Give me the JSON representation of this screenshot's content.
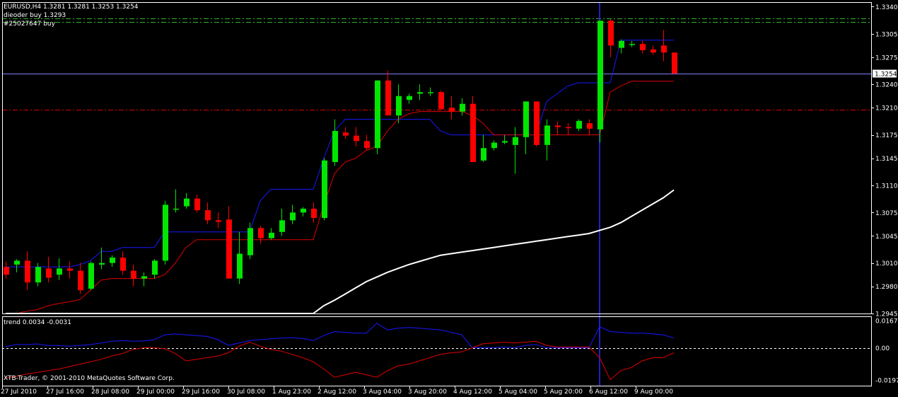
{
  "colors": {
    "background": "#000000",
    "foreground": "#ffffff",
    "bull": "#00e600",
    "bear": "#ff0000",
    "upper_band": "#1818ff",
    "lower_band": "#e00000",
    "ma": "#ffffff",
    "level_green": "#2fb52f",
    "level_red": "#e00000",
    "cursor_line": "#2a2aff",
    "bid_line": "#8080ff"
  },
  "header": {
    "symbol_line": "EURUSD,H4  1.3281 1.3281 1.3253 1.3254",
    "order_line_1": "dieoder buy  1.3293",
    "order_line_2": "#25027647 buy"
  },
  "indicator": {
    "label": "trend 0.0034 -0.0031",
    "axis_labels": [
      "0.0167",
      "0.00",
      "-0.0197"
    ]
  },
  "watermark": "XTB-Trader, © 2001-2010 MetaQuotes Software Corp.",
  "current_price": "1.3254",
  "chart_data": {
    "type": "candlestick",
    "symbol": "EURUSD",
    "timeframe": "H4",
    "ylim": [
      1.2945,
      1.3345
    ],
    "y_ticks": [
      "1.3340",
      "1.3305",
      "1.3275",
      "1.3240",
      "1.3210",
      "1.3175",
      "1.3145",
      "1.3110",
      "1.3075",
      "1.3045",
      "1.3010",
      "1.2980",
      "1.2945"
    ],
    "x_ticks": [
      "27 Jul 2010",
      "27 Jul 16:00",
      "28 Jul 08:00",
      "29 Jul 00:00",
      "29 Jul 16:00",
      "30 Jul 08:00",
      "1 Aug 23:00",
      "2 Aug 12:00",
      "3 Aug 04:00",
      "3 Aug 20:00",
      "4 Aug 12:00",
      "5 Aug 04:00",
      "5 Aug 20:00",
      "6 Aug 12:00",
      "9 Aug 00:00"
    ],
    "candles": [
      [
        1.3005,
        1.3012,
        1.299,
        1.2995
      ],
      [
        1.3008,
        1.3015,
        1.2998,
        1.3013
      ],
      [
        1.3013,
        1.3025,
        1.2975,
        1.2985
      ],
      [
        1.2985,
        1.301,
        1.298,
        1.3005
      ],
      [
        1.3003,
        1.3018,
        1.2985,
        1.2991
      ],
      [
        1.2995,
        1.3016,
        1.2988,
        1.3003
      ],
      [
        1.3003,
        1.3012,
        1.299,
        1.3
      ],
      [
        1.3,
        1.301,
        1.297,
        1.2975
      ],
      [
        1.2977,
        1.3012,
        1.2975,
        1.301
      ],
      [
        1.3008,
        1.303,
        1.3002,
        1.301
      ],
      [
        1.301,
        1.302,
        1.3005,
        1.3017
      ],
      [
        1.3017,
        1.3025,
        1.2995,
        1.3
      ],
      [
        1.3,
        1.3008,
        1.298,
        1.299
      ],
      [
        1.299,
        1.2998,
        1.298,
        1.2993
      ],
      [
        1.2995,
        1.3015,
        1.299,
        1.3013
      ],
      [
        1.3013,
        1.309,
        1.3008,
        1.3085
      ],
      [
        1.308,
        1.3105,
        1.3075,
        1.308
      ],
      [
        1.3083,
        1.31,
        1.308,
        1.3093
      ],
      [
        1.3093,
        1.3098,
        1.3075,
        1.3078
      ],
      [
        1.3078,
        1.3088,
        1.306,
        1.3065
      ],
      [
        1.3065,
        1.3075,
        1.3055,
        1.3063
      ],
      [
        1.3066,
        1.3083,
        1.299,
        1.299
      ],
      [
        1.299,
        1.305,
        1.2983,
        1.3022
      ],
      [
        1.302,
        1.3062,
        1.3015,
        1.3055
      ],
      [
        1.3055,
        1.3058,
        1.3035,
        1.3042
      ],
      [
        1.3042,
        1.3055,
        1.304,
        1.3049
      ],
      [
        1.305,
        1.308,
        1.3045,
        1.3065
      ],
      [
        1.3065,
        1.3085,
        1.306,
        1.3075
      ],
      [
        1.3075,
        1.3082,
        1.307,
        1.308
      ],
      [
        1.308,
        1.3088,
        1.3062,
        1.3068
      ],
      [
        1.3068,
        1.3145,
        1.3065,
        1.3142
      ],
      [
        1.314,
        1.3195,
        1.3135,
        1.318
      ],
      [
        1.3178,
        1.3185,
        1.317,
        1.3174
      ],
      [
        1.3174,
        1.3185,
        1.316,
        1.3167
      ],
      [
        1.3167,
        1.3175,
        1.3155,
        1.3158
      ],
      [
        1.3158,
        1.3245,
        1.315,
        1.3245
      ],
      [
        1.3245,
        1.3258,
        1.32,
        1.32
      ],
      [
        1.32,
        1.324,
        1.319,
        1.3225
      ],
      [
        1.322,
        1.3228,
        1.3215,
        1.3225
      ],
      [
        1.3228,
        1.324,
        1.322,
        1.323
      ],
      [
        1.323,
        1.3236,
        1.3225,
        1.323
      ],
      [
        1.323,
        1.3232,
        1.3208,
        1.3208
      ],
      [
        1.321,
        1.3225,
        1.3195,
        1.3205
      ],
      [
        1.3205,
        1.3222,
        1.32,
        1.3215
      ],
      [
        1.3215,
        1.3225,
        1.314,
        1.314
      ],
      [
        1.3142,
        1.3175,
        1.314,
        1.3158
      ],
      [
        1.3158,
        1.3168,
        1.3155,
        1.3165
      ],
      [
        1.3165,
        1.3175,
        1.3163,
        1.3167
      ],
      [
        1.3162,
        1.3185,
        1.3125,
        1.3172
      ],
      [
        1.3172,
        1.3218,
        1.315,
        1.3218
      ],
      [
        1.3218,
        1.3218,
        1.316,
        1.3162
      ],
      [
        1.3162,
        1.3195,
        1.3142,
        1.3187
      ],
      [
        1.3187,
        1.3192,
        1.3175,
        1.3185
      ],
      [
        1.3185,
        1.319,
        1.3175,
        1.3184
      ],
      [
        1.3183,
        1.3195,
        1.318,
        1.3193
      ],
      [
        1.319,
        1.3195,
        1.3175,
        1.3183
      ],
      [
        1.3182,
        1.3322,
        1.3165,
        1.3322
      ],
      [
        1.3322,
        1.3324,
        1.3275,
        1.329
      ],
      [
        1.3287,
        1.3298,
        1.328,
        1.3296
      ],
      [
        1.3292,
        1.3296,
        1.3288,
        1.3292
      ],
      [
        1.3292,
        1.3296,
        1.328,
        1.3284
      ],
      [
        1.3285,
        1.329,
        1.3278,
        1.3281
      ],
      [
        1.329,
        1.331,
        1.327,
        1.3281
      ],
      [
        1.3281,
        1.3281,
        1.3253,
        1.3254
      ]
    ],
    "upper_band": [
      1.3005,
      1.3005,
      1.3005,
      1.3005,
      1.3005,
      1.3005,
      1.3005,
      1.3008,
      1.3013,
      1.3025,
      1.3025,
      1.303,
      1.303,
      1.303,
      1.303,
      1.305,
      1.305,
      1.305,
      1.305,
      1.305,
      1.305,
      1.305,
      1.305,
      1.305,
      1.309,
      1.3105,
      1.3105,
      1.3105,
      1.3105,
      1.3105,
      1.3145,
      1.318,
      1.3195,
      1.3195,
      1.3195,
      1.3195,
      1.3195,
      1.3195,
      1.3195,
      1.3195,
      1.3195,
      1.318,
      1.3175,
      1.3175,
      1.3175,
      1.3175,
      1.3175,
      1.3175,
      1.3175,
      1.3175,
      1.3175,
      1.3218,
      1.3228,
      1.3238,
      1.3242,
      1.3242,
      1.3242,
      1.3242,
      1.3297,
      1.3297,
      1.3297,
      1.3297,
      1.3297,
      1.3297
    ],
    "lower_band": [
      1.2945,
      1.2945,
      1.2948,
      1.295,
      1.2955,
      1.2958,
      1.296,
      1.2963,
      1.2975,
      1.2988,
      1.299,
      1.299,
      1.299,
      1.299,
      1.299,
      1.2995,
      1.301,
      1.303,
      1.304,
      1.304,
      1.304,
      1.304,
      1.304,
      1.304,
      1.304,
      1.304,
      1.304,
      1.304,
      1.304,
      1.304,
      1.3085,
      1.3125,
      1.314,
      1.3145,
      1.3155,
      1.316,
      1.318,
      1.3195,
      1.3202,
      1.3205,
      1.3205,
      1.3205,
      1.3205,
      1.3205,
      1.32,
      1.319,
      1.3175,
      1.3175,
      1.3175,
      1.3175,
      1.3175,
      1.3175,
      1.3175,
      1.3175,
      1.3175,
      1.3175,
      1.3175,
      1.323,
      1.3238,
      1.3244,
      1.3244,
      1.3244,
      1.3244,
      1.3244
    ],
    "ma": [
      1.2945,
      1.2945,
      1.2945,
      1.2945,
      1.2945,
      1.2945,
      1.2945,
      1.2945,
      1.2945,
      1.2945,
      1.2945,
      1.2945,
      1.2945,
      1.2945,
      1.2945,
      1.2945,
      1.2945,
      1.2945,
      1.2945,
      1.2945,
      1.2945,
      1.2945,
      1.2945,
      1.2945,
      1.2945,
      1.2945,
      1.2945,
      1.2945,
      1.2945,
      1.2945,
      1.2955,
      1.2962,
      1.297,
      1.2978,
      1.2986,
      1.2992,
      1.2998,
      1.3003,
      1.3008,
      1.3012,
      1.3016,
      1.302,
      1.3022,
      1.3024,
      1.3026,
      1.3028,
      1.303,
      1.3032,
      1.3034,
      1.3036,
      1.3038,
      1.304,
      1.3042,
      1.3044,
      1.3046,
      1.3048,
      1.3052,
      1.3056,
      1.3062,
      1.307,
      1.3078,
      1.3086,
      1.3094,
      1.3104
    ],
    "levels": [
      {
        "price": 1.3325,
        "style": "green-dashdot"
      },
      {
        "price": 1.332,
        "style": "green-dashdot"
      },
      {
        "price": 1.3207,
        "style": "red-dashdot"
      }
    ],
    "cursor_index": 56,
    "indicator_series": {
      "ylim": [
        -0.0197,
        0.0167
      ],
      "blue": [
        0.0008,
        0.002,
        0.002,
        0.0024,
        0.0015,
        0.0015,
        0.001,
        0.0015,
        0.002,
        0.003,
        0.004,
        0.0045,
        0.004,
        0.0042,
        0.005,
        0.008,
        0.0085,
        0.008,
        0.0075,
        0.007,
        0.005,
        0.0015,
        0.003,
        0.0045,
        0.005,
        0.0055,
        0.006,
        0.0062,
        0.0058,
        0.0045,
        0.0075,
        0.01,
        0.0095,
        0.009,
        0.009,
        0.015,
        0.011,
        0.012,
        0.0125,
        0.012,
        0.0115,
        0.011,
        0.0095,
        0.008,
        0.0,
        0.0,
        0.0,
        0.0005,
        0.0,
        0.0015,
        0.002,
        0.0,
        0.0,
        0.0,
        0.0,
        0.0,
        0.013,
        0.01,
        0.0095,
        0.009,
        0.009,
        0.0085,
        0.008,
        0.006
      ],
      "red": [
        -0.0185,
        -0.0175,
        -0.016,
        -0.015,
        -0.014,
        -0.013,
        -0.0115,
        -0.01,
        -0.0085,
        -0.007,
        -0.005,
        -0.0035,
        -0.001,
        0.0,
        0.0,
        -0.0005,
        -0.0035,
        -0.008,
        -0.007,
        -0.006,
        -0.005,
        -0.003,
        0.001,
        0.0035,
        0.001,
        -0.001,
        -0.002,
        -0.004,
        -0.006,
        -0.0085,
        -0.013,
        -0.018,
        -0.0165,
        -0.015,
        -0.0165,
        -0.018,
        -0.014,
        -0.011,
        -0.01,
        -0.008,
        -0.006,
        -0.004,
        -0.003,
        -0.0025,
        0.0,
        0.0025,
        0.003,
        0.0035,
        0.003,
        0.0035,
        0.004,
        0.0015,
        0.0005,
        0.0005,
        0.0005,
        0.0005,
        -0.006,
        -0.0195,
        -0.014,
        -0.012,
        -0.008,
        -0.006,
        -0.006,
        -0.003
      ]
    }
  }
}
